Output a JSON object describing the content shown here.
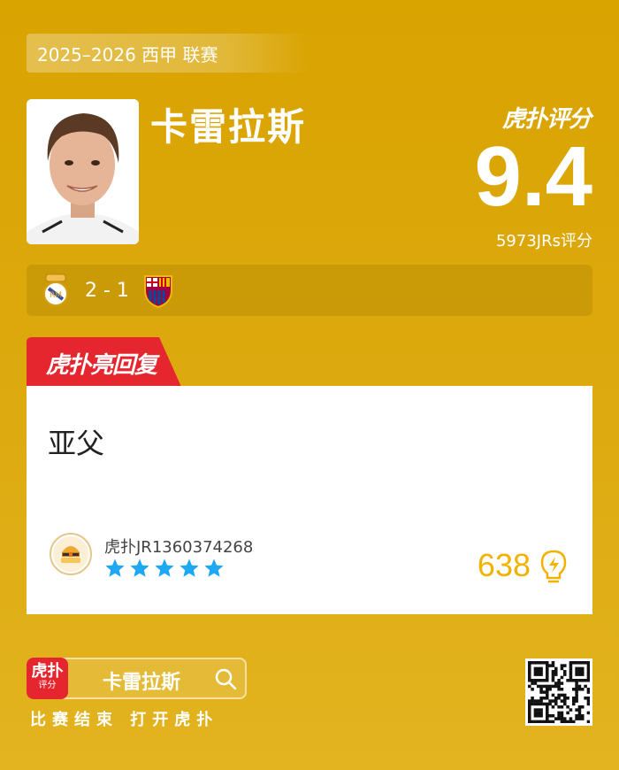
{
  "header": {
    "league": "2025–2026 西甲 联赛",
    "player_name": "卡雷拉斯",
    "brand": "虎扑评分",
    "score": "9.4",
    "votes": "5973JRs评分"
  },
  "match": {
    "score": "2 - 1",
    "home_crest": "real-madrid-crest-icon",
    "away_crest": "barcelona-crest-icon"
  },
  "reply": {
    "tab_label": "虎扑亮回复",
    "comment": "亚父",
    "username": "虎扑JR1360374268",
    "stars": 5,
    "likes": "638"
  },
  "footer": {
    "app_icon_top": "虎扑",
    "app_icon_bottom": "评分",
    "search_text": "卡雷拉斯",
    "cta": "比赛结束 打开虎扑"
  },
  "colors": {
    "background": "#dba700",
    "tab_red": "#e6262e",
    "star_blue": "#1ea7f5",
    "likes_gold": "#f3b100"
  }
}
